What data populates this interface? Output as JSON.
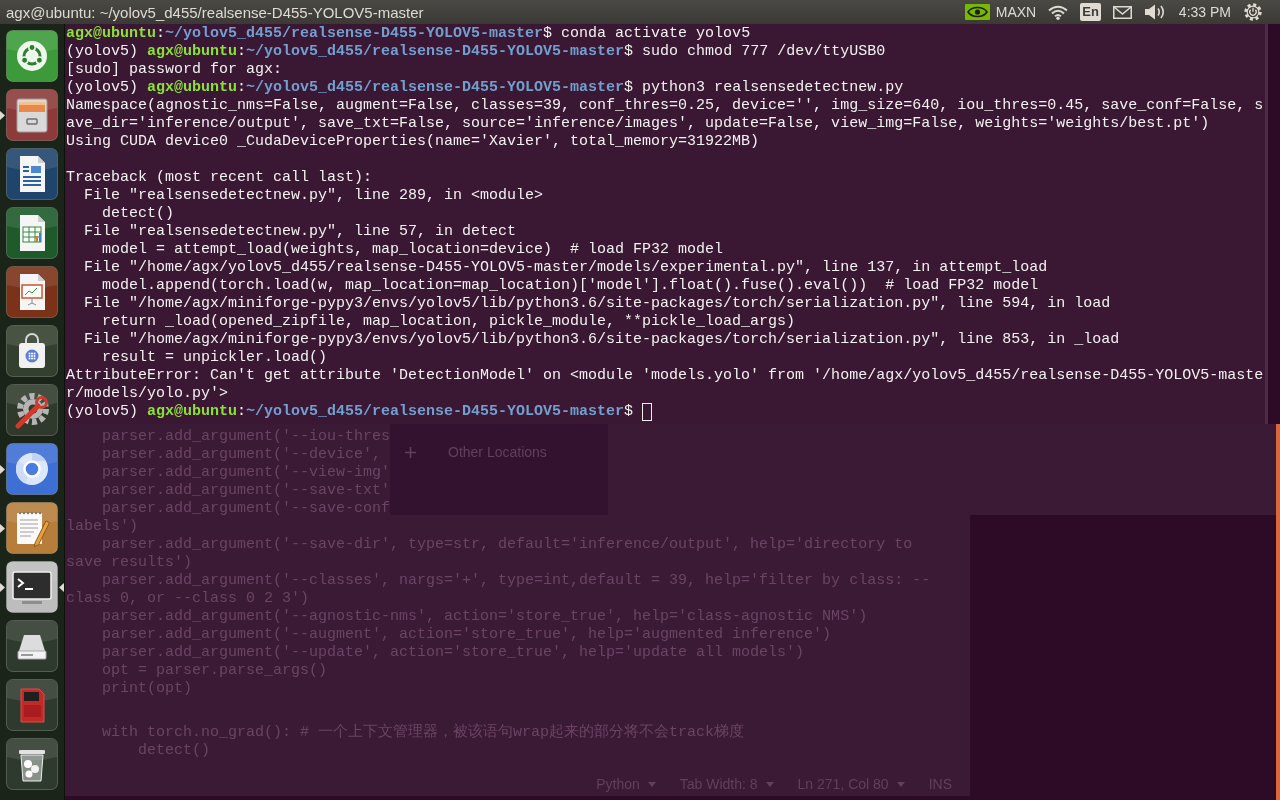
{
  "top_bar": {
    "title": "agx@ubuntu: ~/yolov5_d455/realsense-D455-YOLOV5-master",
    "power_mode": "MAXN",
    "keyboard_layout": "En",
    "clock": "4:33 PM"
  },
  "launcher": [
    {
      "kind": "dash",
      "running": false,
      "focused": false
    },
    {
      "kind": "files",
      "running": true,
      "focused": false
    },
    {
      "kind": "writer",
      "running": false,
      "focused": false
    },
    {
      "kind": "calc",
      "running": false,
      "focused": false
    },
    {
      "kind": "impress",
      "running": false,
      "focused": false
    },
    {
      "kind": "software",
      "running": false,
      "focused": false
    },
    {
      "kind": "settings",
      "running": false,
      "focused": false
    },
    {
      "kind": "browser",
      "running": true,
      "focused": false
    },
    {
      "kind": "text-editor",
      "running": true,
      "focused": false
    },
    {
      "kind": "terminal",
      "running": true,
      "focused": true
    },
    {
      "kind": "drive",
      "running": false,
      "focused": false
    },
    {
      "kind": "sd-card",
      "running": false,
      "focused": false
    },
    {
      "kind": "trash",
      "running": false,
      "focused": false
    }
  ],
  "terminal": {
    "cursor": true,
    "lines": [
      {
        "kind": "prompt",
        "segments": [
          {
            "kind": "user",
            "text": "agx@ubuntu"
          },
          {
            "kind": "plain",
            "text": ":"
          },
          {
            "kind": "path",
            "text": "~/yolov5_d455/realsense-D455-YOLOV5-master"
          },
          {
            "kind": "plain",
            "text": "$ conda activate yolov5"
          }
        ]
      },
      {
        "kind": "prompt",
        "segments": [
          {
            "kind": "plain",
            "text": "(yolov5) "
          },
          {
            "kind": "user",
            "text": "agx@ubuntu"
          },
          {
            "kind": "plain",
            "text": ":"
          },
          {
            "kind": "path",
            "text": "~/yolov5_d455/realsense-D455-YOLOV5-master"
          },
          {
            "kind": "plain",
            "text": "$ sudo chmod 777 /dev/ttyUSB0"
          }
        ]
      },
      {
        "kind": "output",
        "text": "[sudo] password for agx:"
      },
      {
        "kind": "prompt",
        "segments": [
          {
            "kind": "plain",
            "text": "(yolov5) "
          },
          {
            "kind": "user",
            "text": "agx@ubuntu"
          },
          {
            "kind": "plain",
            "text": ":"
          },
          {
            "kind": "path",
            "text": "~/yolov5_d455/realsense-D455-YOLOV5-master"
          },
          {
            "kind": "plain",
            "text": "$ python3 realsensedetectnew.py"
          }
        ]
      },
      {
        "kind": "output",
        "text": "Namespace(agnostic_nms=False, augment=False, classes=39, conf_thres=0.25, device='', img_size=640, iou_thres=0.45, save_conf=False, s"
      },
      {
        "kind": "output",
        "text": "ave_dir='inference/output', save_txt=False, source='inference/images', update=False, view_img=False, weights='weights/best.pt')"
      },
      {
        "kind": "output",
        "text": "Using CUDA device0 _CudaDeviceProperties(name='Xavier', total_memory=31922MB)"
      },
      {
        "kind": "blank"
      },
      {
        "kind": "output",
        "text": "Traceback (most recent call last):"
      },
      {
        "kind": "output",
        "text": "  File \"realsensedetectnew.py\", line 289, in <module>"
      },
      {
        "kind": "output",
        "text": "    detect()"
      },
      {
        "kind": "output",
        "text": "  File \"realsensedetectnew.py\", line 57, in detect"
      },
      {
        "kind": "output",
        "text": "    model = attempt_load(weights, map_location=device)  # load FP32 model"
      },
      {
        "kind": "output",
        "text": "  File \"/home/agx/yolov5_d455/realsense-D455-YOLOV5-master/models/experimental.py\", line 137, in attempt_load"
      },
      {
        "kind": "output",
        "text": "    model.append(torch.load(w, map_location=map_location)['model'].float().fuse().eval())  # load FP32 model"
      },
      {
        "kind": "output",
        "text": "  File \"/home/agx/miniforge-pypy3/envs/yolov5/lib/python3.6/site-packages/torch/serialization.py\", line 594, in load"
      },
      {
        "kind": "output",
        "text": "    return _load(opened_zipfile, map_location, pickle_module, **pickle_load_args)"
      },
      {
        "kind": "output",
        "text": "  File \"/home/agx/miniforge-pypy3/envs/yolov5/lib/python3.6/site-packages/torch/serialization.py\", line 853, in _load"
      },
      {
        "kind": "output",
        "text": "    result = unpickler.load()"
      },
      {
        "kind": "output",
        "text": "AttributeError: Can't get attribute 'DetectionModel' on <module 'models.yolo' from '/home/agx/yolov5_d455/realsense-D455-YOLOV5-maste"
      },
      {
        "kind": "output",
        "text": "r/models/yolo.py'>"
      },
      {
        "kind": "prompt",
        "segments": [
          {
            "kind": "plain",
            "text": "(yolov5) "
          },
          {
            "kind": "user",
            "text": "agx@ubuntu"
          },
          {
            "kind": "plain",
            "text": ":"
          },
          {
            "kind": "path",
            "text": "~/yolov5_d455/realsense-D455-YOLOV5-master"
          },
          {
            "kind": "plain",
            "text": "$ "
          }
        ]
      }
    ]
  },
  "file_manager": {
    "sidebar": [
      {
        "kind": "add",
        "label": "Other Locations"
      }
    ]
  },
  "editor": {
    "lines": [
      {
        "kind": "code",
        "text": "    parser.add_argument('--iou-thres"
      },
      {
        "kind": "code",
        "text": "    parser.add_argument('--device',"
      },
      {
        "kind": "code",
        "text": "    parser.add_argument('--view-img'"
      },
      {
        "kind": "code",
        "text": "    parser.add_argument('--save-txt'"
      },
      {
        "kind": "code",
        "text": "    parser.add_argument('--save-conf"
      },
      {
        "kind": "code",
        "text": "labels')"
      },
      {
        "kind": "code",
        "text": "    parser.add_argument('--save-dir', type=str, default='inference/output', help='directory to"
      },
      {
        "kind": "code",
        "text": "save results')"
      },
      {
        "kind": "code",
        "text": "    parser.add_argument('--classes', nargs='+', type=int,default = 39, help='filter by class: --"
      },
      {
        "kind": "code",
        "text": "class 0, or --class 0 2 3')"
      },
      {
        "kind": "code",
        "text": "    parser.add_argument('--agnostic-nms', action='store_true', help='class-agnostic NMS')"
      },
      {
        "kind": "code",
        "text": "    parser.add_argument('--augment', action='store_true', help='augmented inference')"
      },
      {
        "kind": "code",
        "text": "    parser.add_argument('--update', action='store_true', help='update all models')"
      },
      {
        "kind": "code",
        "text": "    opt = parser.parse_args()"
      },
      {
        "kind": "code",
        "text": "    print(opt)"
      },
      {
        "kind": "blank"
      },
      {
        "kind": "code",
        "text": "    with torch.no_grad(): # 一个上下文管理器，被该语句wrap起来的部分将不会track梯度"
      },
      {
        "kind": "code",
        "text": "        detect()"
      }
    ],
    "status_bar": [
      {
        "text": "Python",
        "dropdown": true
      },
      {
        "text": "Tab Width: 8",
        "dropdown": true
      },
      {
        "text": "Ln 271, Col 80",
        "dropdown": true
      },
      {
        "text": "INS",
        "dropdown": false
      }
    ]
  }
}
